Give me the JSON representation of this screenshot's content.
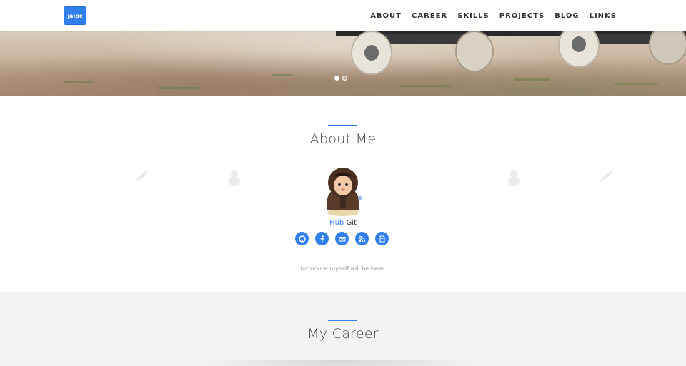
{
  "nav": {
    "logo": "jalpc",
    "items": [
      "ABOUT",
      "CAREER",
      "SKILLS",
      "PROJECTS",
      "BLOG",
      "LINKS"
    ]
  },
  "hero": {
    "image": "skateboard-wheels-photo",
    "slides": 2,
    "active_slide": 1
  },
  "about": {
    "title": "About Me",
    "name_part1": "Hub",
    "name_part2": "Git",
    "socials": [
      "github-icon",
      "facebook-icon",
      "email-icon",
      "rss-icon",
      "resume-icon"
    ],
    "intro": "Introduce myself will be here."
  },
  "career": {
    "title": "My Career"
  },
  "colors": {
    "accent": "#2f80ed",
    "section_bg": "#f3f3f3"
  }
}
